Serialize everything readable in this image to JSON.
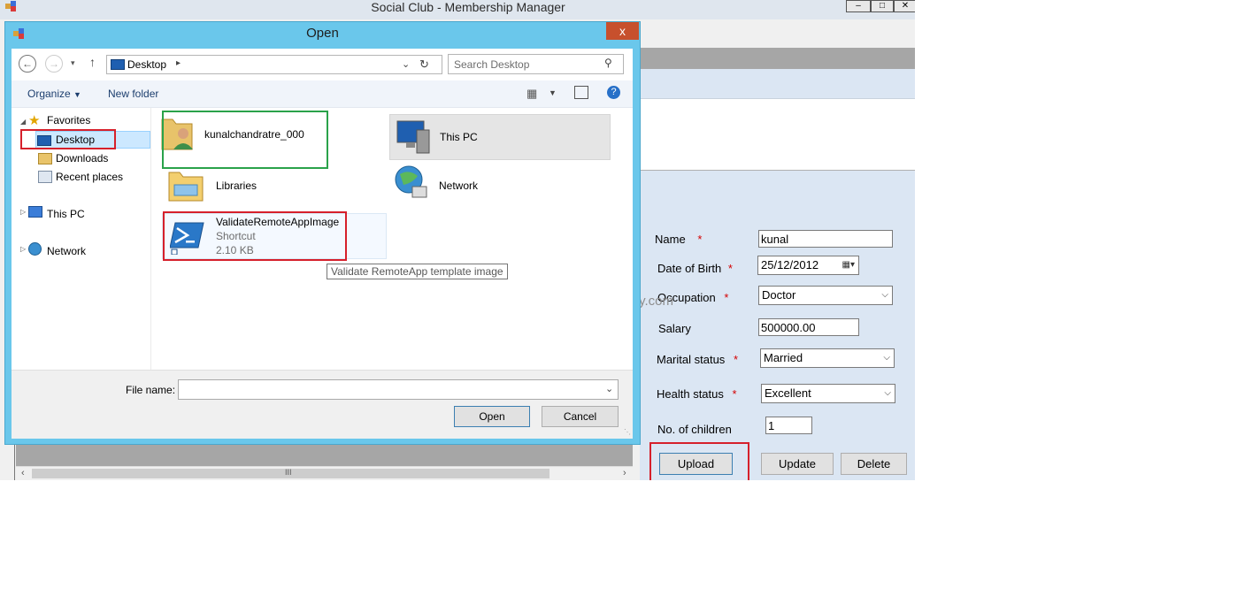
{
  "main_window": {
    "title": "Social Club - Membership Manager",
    "controls": [
      "–",
      "□",
      "✕"
    ]
  },
  "form": {
    "name_label": "Name",
    "name_value": "kunal",
    "dob_label": "Date of Birth",
    "dob_value": "25/12/2012",
    "occupation_label": "Occupation",
    "occupation_value": "Doctor",
    "salary_label": "Salary",
    "salary_value": "500000.00",
    "marital_label": "Marital status",
    "marital_value": "Married",
    "health_label": "Health status",
    "health_value": "Excellent",
    "children_label": "No. of children",
    "children_value": "1",
    "required_mark": "*",
    "upload_label": "Upload",
    "update_label": "Update",
    "delete_label": "Delete"
  },
  "watermark": "@DotNetCurry.com",
  "dialog": {
    "title": "Open",
    "close_glyph": "x",
    "address": "Desktop",
    "search_placeholder": "Search Desktop",
    "organize_label": "Organize",
    "new_folder_label": "New folder",
    "nav": {
      "favorites": "Favorites",
      "desktop": "Desktop",
      "downloads": "Downloads",
      "recent": "Recent places",
      "this_pc": "This PC",
      "network": "Network"
    },
    "items": {
      "user_folder": "kunalchandratre_000",
      "this_pc": "This PC",
      "libraries": "Libraries",
      "network": "Network",
      "shortcut_name": "ValidateRemoteAppImage",
      "shortcut_type": "Shortcut",
      "shortcut_size": "2.10 KB"
    },
    "tooltip": "Validate RemoteApp template image",
    "file_name_label": "File name:",
    "file_name_value": "",
    "open_label": "Open",
    "cancel_label": "Cancel"
  },
  "scrollbar_grip": "III",
  "colors": {
    "dialog_frame": "#6ac7eb",
    "close_button": "#c7502d",
    "highlight_red": "#d6202b",
    "highlight_green": "#2aa24a",
    "form_panel": "#dbe6f3"
  }
}
